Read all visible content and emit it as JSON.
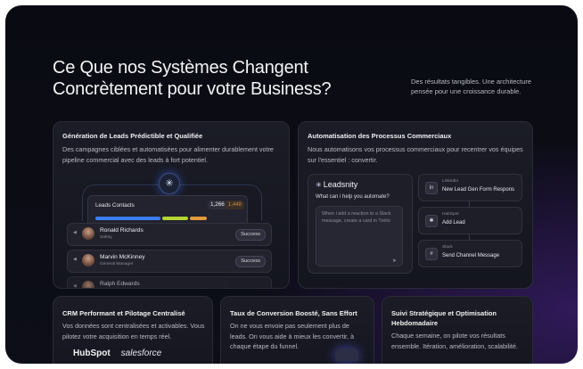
{
  "hero": {
    "title_line1": "Ce Que nos Systèmes Changent",
    "title_line2": "Concrètement pour votre Business?",
    "subtitle": "Des résultats tangibles. Une architecture pensée pour une croissance durable."
  },
  "card_leads": {
    "title": "Génération de Leads Prédictible et Qualifiée",
    "description": "Des campagnes ciblées et automatisées pour alimenter durablement votre pipeline commercial avec des leads à fort potentiel.",
    "hub_icon": "asterisk-icon",
    "panel_title": "Leads Contacts",
    "count": "1,266",
    "count_secondary": "1,448",
    "progress": [
      {
        "label": "blue",
        "color": "#3d7ef5",
        "fraction": 0.45
      },
      {
        "label": "green",
        "color": "#b4d633",
        "fraction": 0.18
      },
      {
        "label": "orange",
        "color": "#e59a3c",
        "fraction": 0.12
      }
    ],
    "rows": [
      {
        "name": "Ronald Richards",
        "role": "Safety",
        "status": "Success"
      },
      {
        "name": "Marvin McKinney",
        "role": "General Manager",
        "status": "Success"
      },
      {
        "name": "Ralph Edwards",
        "role": "",
        "status": ""
      }
    ]
  },
  "card_automation": {
    "title": "Automatisation des Processus Commerciaux",
    "description": "Nous automatisons vos processus commerciaux pour recentrer vos équipes sur l'essentiel : convertir.",
    "chat": {
      "brand": "Leadsnity",
      "prompt": "What can i help you automate?",
      "input_text": "When i add a reaction to a Slack message, create a card in Trello"
    },
    "integrations": [
      {
        "app": "LinkedIn",
        "event": "New Lead Gen Form Respons",
        "icon": "linkedin-icon",
        "glyph": "in"
      },
      {
        "app": "HubSpot",
        "event": "Add Lead",
        "icon": "hubspot-icon",
        "glyph": "✱"
      },
      {
        "app": "Slack",
        "event": "Send Channel Message",
        "icon": "slack-icon",
        "glyph": "#"
      }
    ]
  },
  "card_crm": {
    "title": "CRM Performant et Pilotage Centralisé",
    "description": "Vos données sont centralisées et activables. Vous pilotez votre acquisition en temps réel.",
    "logo1": "HubSpot",
    "logo2": "salesforce"
  },
  "card_conversion": {
    "title": "Taux de Conversion Boosté, Sans Effort",
    "description": "On ne vous envoie pas seulement plus de leads. On vous aide à mieux les convertir, à chaque étape du funnel."
  },
  "card_tracking": {
    "title": "Suivi Stratégique et Optimisation Hebdomadaire",
    "description": "Chaque semaine, on pilote vos résultats ensemble. Itération, amélioration, scalabilité."
  }
}
